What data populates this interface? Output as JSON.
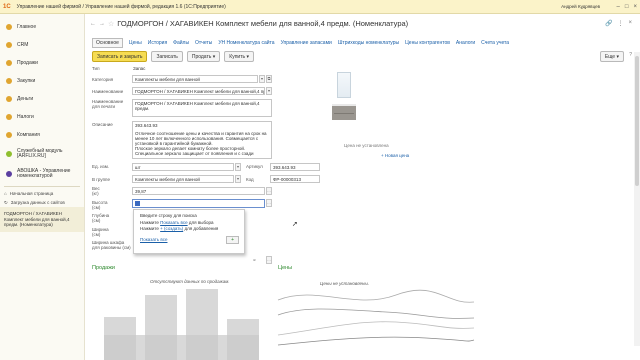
{
  "titlebar": {
    "logo": "1С",
    "title": "Управление нашей фирмой / Управление нашей фирмой, редакция 1.6  (1С:Предприятие)",
    "user": "Андрей Кудрявцев"
  },
  "sidebar": {
    "items": [
      {
        "label": "Главное",
        "color": "#e0a530"
      },
      {
        "label": "CRM",
        "color": "#e0a530"
      },
      {
        "label": "Продажи",
        "color": "#e0a530"
      },
      {
        "label": "Закупки",
        "color": "#e0a530"
      },
      {
        "label": "Деньги",
        "color": "#e0a530"
      },
      {
        "label": "Налоги",
        "color": "#e0a530"
      },
      {
        "label": "Компания",
        "color": "#e0a530"
      },
      {
        "label": "Служебный модуль [ARFLIX.RU]",
        "color": "#8fbf2f"
      },
      {
        "label": "АВОШКА - Управление номенклатурой",
        "color": "#5b3fa0"
      }
    ],
    "links": [
      "Начальная страница",
      "Загрузка данных с сайтов"
    ],
    "active_note": "ГОДМОРГОН / ХАГАВИКЕН Комплект мебели для ванной,4 предм. (Номенклатура)"
  },
  "header": {
    "title": "ГОДМОРГОН / ХАГАВИКЕН Комплект мебели для ванной,4 предм. (Номенклатура)"
  },
  "tabs": [
    "Основное",
    "Цены",
    "История",
    "Файлы",
    "Отчеты",
    "УН Номенклатура сайта",
    "Управление запасами",
    "Штрихкоды номенклатуры",
    "Цены контрагентов",
    "Аналоги",
    "Счета учета"
  ],
  "toolbar": {
    "save_close": "Записать и закрыть",
    "save": "Записать",
    "sell": "Продать",
    "buy": "Купить",
    "more": "Еще"
  },
  "form": {
    "type_label": "Тип",
    "type_value": "Запас",
    "category_label": "Категория",
    "category_value": "Комплекты мебели для ванной",
    "name_label": "Наименование",
    "name_value": "ГОДМОРГОН / ХАГАВИКЕН Комплект мебели для ванной,4 пред",
    "print_name_label": "Наименование для печати",
    "print_name_value": "ГОДМОРГОН / ХАГАВИКЕН Комплект мебели для ванной,4 предм.",
    "description_label": "Описание",
    "description_lines": [
      "393.643.93",
      "",
      "Отличное соотношение цены и качества и гарантия на срок на",
      "менее 10 лет включенного использования. Совмещается с",
      "установкой в гарантийной бумажной.",
      "Плоское зеркало делает комнату более просторной.",
      "Специальное зеркало защищает от появления и с сзади"
    ],
    "unit_label": "Ед. изм.",
    "unit_value": "шт",
    "article_label": "Артикул",
    "article_value": "393.643.93",
    "group_label": "В группе",
    "group_value": "Комплекты мебели для ванной",
    "code_label": "Код",
    "code_value": "ФР-00000313",
    "weight_label": "Вес (кг)",
    "weight_value": "39,87",
    "height_label": "Высота (см)",
    "depth_label": "Глубина (см)",
    "width_label": "Ширина (см)",
    "cabinet_width_label": "Ширина шкафа для раковины (см)",
    "not_set": "Ценa не установлена",
    "new_price": "+ Новая цена"
  },
  "popup": {
    "line1": "Введите строку для поиска",
    "line2_prefix": "Нажмите",
    "line2_link": "Показать все",
    "line2_suffix": "для выбора",
    "line3_prefix": "Нажмите",
    "line3_link": "+ (создать)",
    "line3_suffix": "для добавления",
    "show_all": "Показать все",
    "add_btn": "+"
  },
  "sales": {
    "title": "Продажи",
    "note": "Отсутствуют данных по продажам."
  },
  "prices": {
    "title": "Цены",
    "note": "Цены не установлены."
  }
}
